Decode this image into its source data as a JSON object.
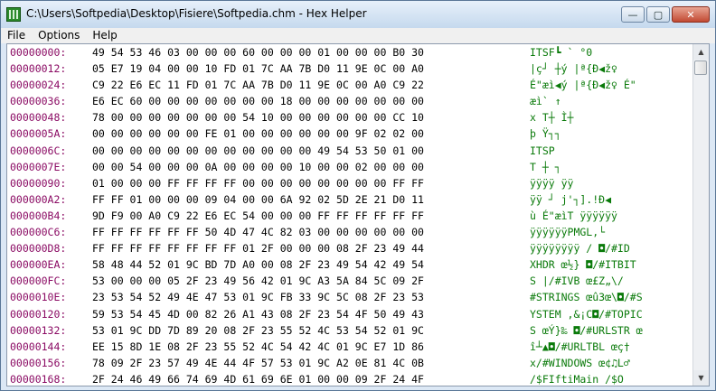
{
  "window": {
    "title": "C:\\Users\\Softpedia\\Desktop\\Fisiere\\Softpedia.chm - Hex Helper"
  },
  "caption": {
    "minimize": "—",
    "maximize": "▢",
    "close": "✕"
  },
  "menu": {
    "items": [
      "File",
      "Options",
      "Help"
    ]
  },
  "scrollbar": {
    "up": "▲",
    "down": "▼"
  },
  "rows": [
    {
      "addr": "00000000:",
      "hex": "49 54 53 46 03 00 00 00 60 00 00 00 01 00 00 00 B0 30",
      "ascii": "ITSF┗  `   °0"
    },
    {
      "addr": "00000012:",
      "hex": "05 E7 19 04 00 00 10 FD 01 7C AA 7B D0 11 9E 0C 00 A0",
      "ascii": "|ç┘  ┼ý  |ª{Ð◀ž♀"
    },
    {
      "addr": "00000024:",
      "hex": "C9 22 E6 EC 11 FD 01 7C AA 7B D0 11 9E 0C 00 A0 C9 22",
      "ascii": "É\"æì◀ý  |ª{Ð◀ž♀  É\""
    },
    {
      "addr": "00000036:",
      "hex": "E6 EC 60 00 00 00 00 00 00 00 18 00 00 00 00 00 00 00",
      "ascii": "æì`      ↑"
    },
    {
      "addr": "00000048:",
      "hex": "78 00 00 00 00 00 00 00 54 10 00 00 00 00 00 00 CC 10",
      "ascii": "x       T┼      Ì┼"
    },
    {
      "addr": "0000005A:",
      "hex": "00 00 00 00 00 00 FE 01 00 00 00 00 00 00 9F 02 02 00",
      "ascii": "      þ       Ÿ┐┐"
    },
    {
      "addr": "0000006C:",
      "hex": "00 00 00 00 00 00 00 00 00 00 00 00 49 54 53 50 01 00",
      "ascii": "            ITSP"
    },
    {
      "addr": "0000007E:",
      "hex": "00 00 54 00 00 00 0A 00 00 00 00 10 00 00 02 00 00 00",
      "ascii": "  T       ┼  ┐"
    },
    {
      "addr": "00000090:",
      "hex": "01 00 00 00 FF FF FF FF 00 00 00 00 00 00 00 00 FF FF",
      "ascii": "    ÿÿÿÿ        ÿÿ"
    },
    {
      "addr": "000000A2:",
      "hex": "FF FF 01 00 00 00 09 04 00 00 6A 92 02 5D 2E 21 D0 11",
      "ascii": "ÿÿ      ┘  j'┐].!Ð◀"
    },
    {
      "addr": "000000B4:",
      "hex": "9D F9 00 A0 C9 22 E6 EC 54 00 00 00 FF FF FF FF FF FF",
      "ascii": "ù  É\"æìT   ÿÿÿÿÿÿ"
    },
    {
      "addr": "000000C6:",
      "hex": "FF FF FF FF FF FF 50 4D 47 4C 82 03 00 00 00 00 00 00",
      "ascii": "ÿÿÿÿÿÿPMGL,└"
    },
    {
      "addr": "000000D8:",
      "hex": "FF FF FF FF FF FF FF FF 01 2F 00 00 00 08 2F 23 49 44",
      "ascii": "ÿÿÿÿÿÿÿÿ /   ◘/#ID"
    },
    {
      "addr": "000000EA:",
      "hex": "58 48 44 52 01 9C BD 7D A0 00 08 2F 23 49 54 42 49 54",
      "ascii": "XHDR œ½}  ◘/#ITBIT"
    },
    {
      "addr": "000000FC:",
      "hex": "53 00 00 00 05 2F 23 49 56 42 01 9C A3 5A 84 5C 09 2F",
      "ascii": "S   |/#IVB œ£Z„\\/"
    },
    {
      "addr": "0000010E:",
      "hex": "23 53 54 52 49 4E 47 53 01 9C FB 33 9C 5C 08 2F 23 53",
      "ascii": "#STRINGS œû3œ\\◘/#S"
    },
    {
      "addr": "00000120:",
      "hex": "59 53 54 45 4D 00 82 26 A1 43 08 2F 23 54 4F 50 49 43",
      "ascii": "YSTEM ‚&¡C◘/#TOPIC"
    },
    {
      "addr": "00000132:",
      "hex": "53 01 9C DD 7D 89 20 08 2F 23 55 52 4C 53 54 52 01 9C",
      "ascii": "S œÝ}‰ ◘/#URLSTR œ"
    },
    {
      "addr": "00000144:",
      "hex": "EE 15 8D 1E 08 2F 23 55 52 4C 54 42 4C 01 9C E7 1D 86",
      "ascii": "î┴▲◘/#URLTBL œç†"
    },
    {
      "addr": "00000156:",
      "hex": "78 09 2F 23 57 49 4E 44 4F 57 53 01 9C A2 0E 81 4C 0B",
      "ascii": "x/#WINDOWS œ¢♫L♂"
    },
    {
      "addr": "00000168:",
      "hex": "2F 24 46 49 66 74 69 4D 61 69 6E 01 00 00 09 2F 24 4F",
      "ascii": "/$FIftiMain   /$O"
    }
  ]
}
